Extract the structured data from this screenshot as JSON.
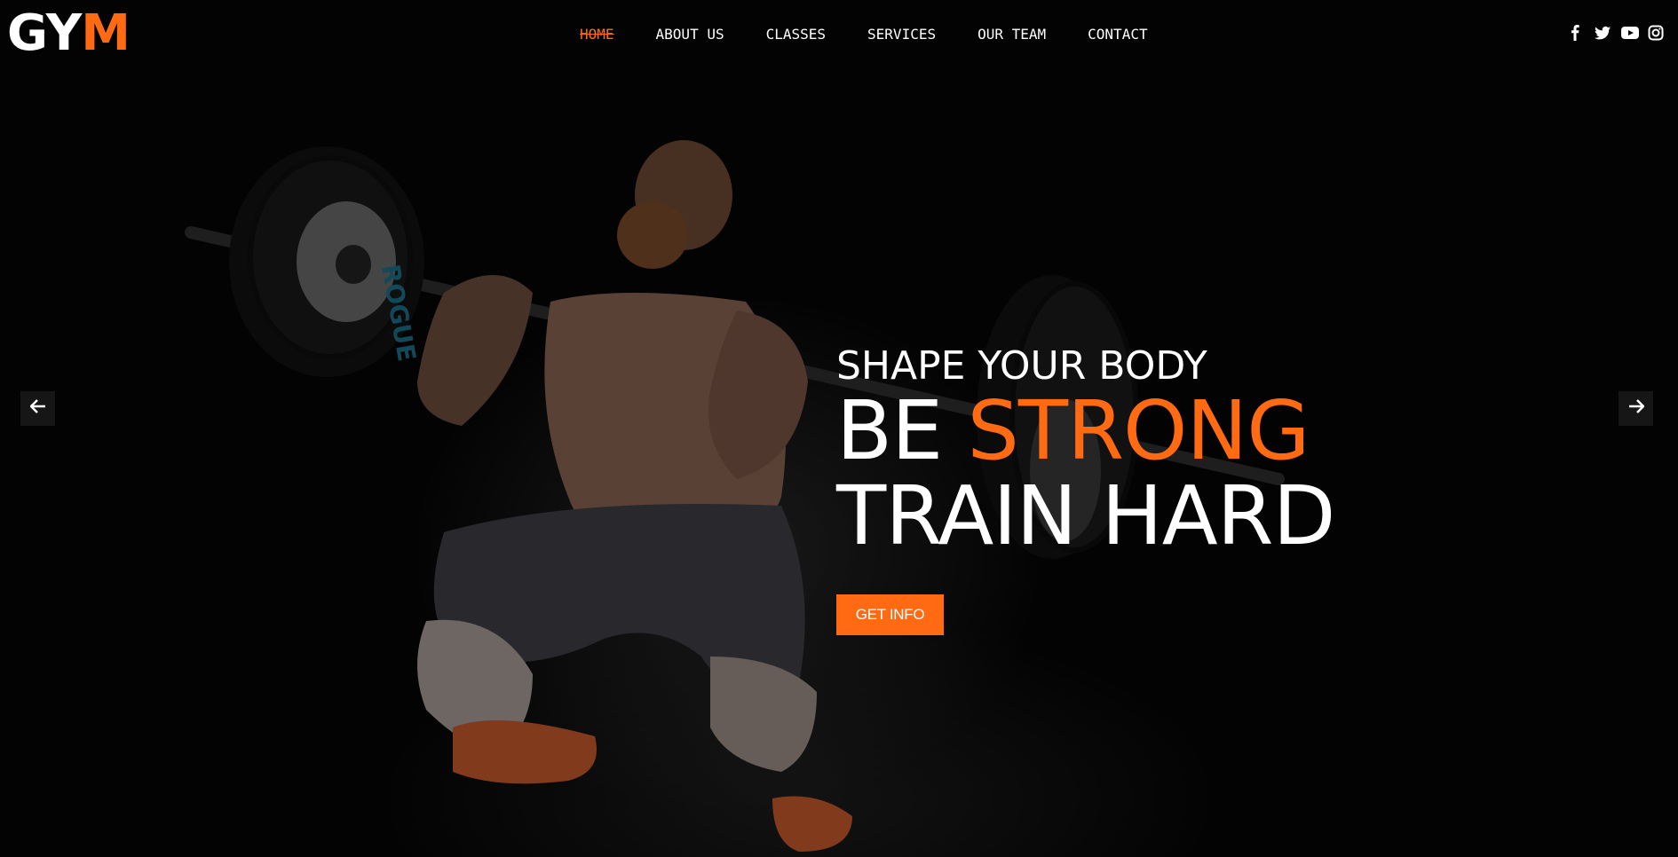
{
  "logo": {
    "main": "GY",
    "accent": "M"
  },
  "nav": {
    "items": [
      {
        "label": "HOME",
        "active": true
      },
      {
        "label": "ABOUT US"
      },
      {
        "label": "CLASSES"
      },
      {
        "label": "SERVICES"
      },
      {
        "label": "OUR TEAM"
      },
      {
        "label": "CONTACT"
      }
    ]
  },
  "social": {
    "icons": [
      "facebook-icon",
      "twitter-icon",
      "youtube-icon",
      "instagram-icon"
    ]
  },
  "hero": {
    "tagline": "SHAPE YOUR BODY",
    "line2_prefix": "BE",
    "line2_accent": "STRONG",
    "line3": "TRAIN HARD",
    "cta_label": "GET INFO",
    "plate_text": "ROGUE"
  },
  "slider": {
    "prev_icon": "arrow-left-icon",
    "next_icon": "arrow-right-icon"
  },
  "colors": {
    "accent": "#ff6a13",
    "background": "#050505",
    "text": "#ffffff"
  }
}
